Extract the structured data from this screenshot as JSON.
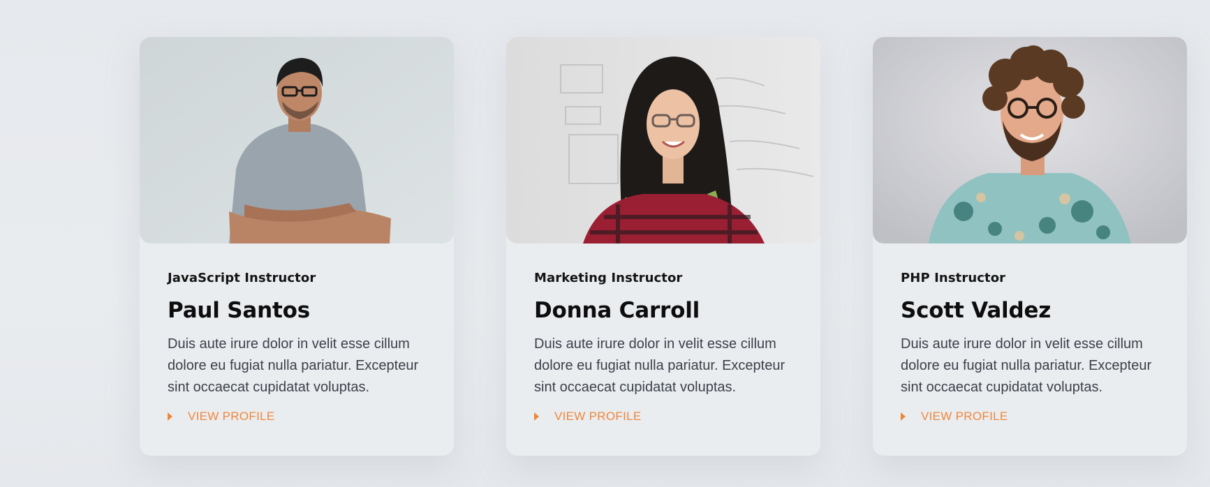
{
  "accent_color": "#f0863a",
  "cards": [
    {
      "role": "JavaScript Instructor",
      "name": "Paul Santos",
      "description": "Duis aute irure dolor in velit esse cillum dolore eu fugiat nulla pariatur. Excepteur sint occaecat cupidatat voluptas.",
      "link_label": "VIEW PROFILE",
      "link_icon": "caret-right-icon"
    },
    {
      "role": "Marketing Instructor",
      "name": "Donna Carroll",
      "description": "Duis aute irure dolor in velit esse cillum dolore eu fugiat nulla pariatur. Excepteur sint occaecat cupidatat voluptas.",
      "link_label": "VIEW PROFILE",
      "link_icon": "caret-right-icon"
    },
    {
      "role": "PHP Instructor",
      "name": "Scott Valdez",
      "description": "Duis aute irure dolor in velit esse cillum dolore eu fugiat nulla pariatur. Excepteur sint occaecat cupidatat voluptas.",
      "link_label": "VIEW PROFILE",
      "link_icon": "caret-right-icon"
    }
  ]
}
